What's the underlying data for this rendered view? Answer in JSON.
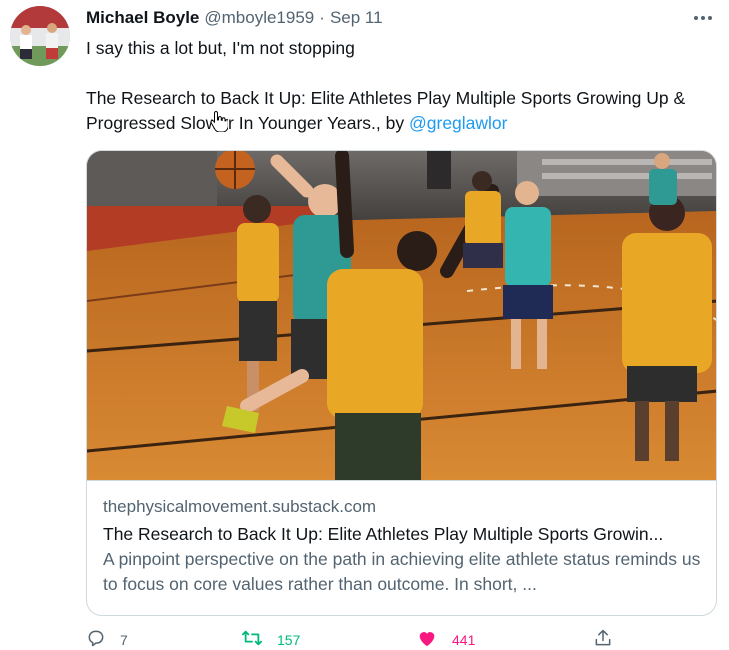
{
  "author": {
    "name": "Michael Boyle",
    "handle": "@mboyle1959",
    "separator": "·",
    "date": "Sep 11"
  },
  "tweet": {
    "line1": "I say this a lot but, I'm not stopping",
    "line2_text": "The Research to Back It Up: Elite Athletes Play Multiple Sports Growing Up & Progressed Slower In Younger Years., by ",
    "mention": "@greglawlor"
  },
  "card": {
    "domain": "thephysicalmovement.substack.com",
    "title": "The Research to Back It Up: Elite Athletes Play Multiple Sports Growin...",
    "description": "A pinpoint perspective on the path in achieving elite athlete status reminds us to focus on core values rather than outcome. In short, ..."
  },
  "actions": {
    "reply_count": "7",
    "retweet_count": "157",
    "like_count": "441"
  },
  "colors": {
    "link": "#1d9bf0",
    "retweet": "#00ba7c",
    "like": "#f91880",
    "secondary": "#536471"
  },
  "icons": [
    "more-icon",
    "reply-icon",
    "retweet-icon",
    "heart-icon",
    "share-icon",
    "hand-cursor-icon"
  ]
}
